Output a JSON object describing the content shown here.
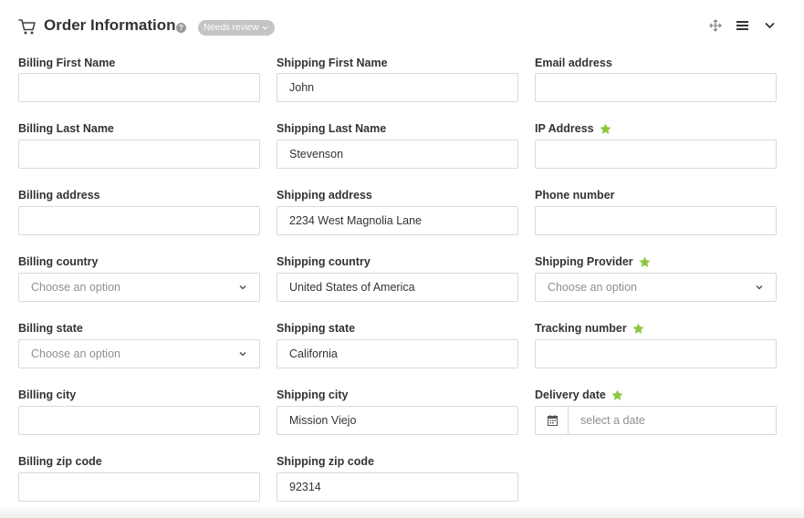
{
  "header": {
    "title": "Order Information",
    "help_icon": "question-circle-icon",
    "status_badge": "Needs review",
    "icons": [
      "cart-icon",
      "move-icon",
      "menu-icon",
      "chevron-down-icon"
    ]
  },
  "colors": {
    "star": "#8cc63f",
    "badge": "#c4c4c4",
    "border": "#d9d9d9",
    "label": "#333333",
    "placeholder": "#8f8f8f"
  },
  "billing": {
    "first_name": {
      "label": "Billing First Name",
      "value": ""
    },
    "last_name": {
      "label": "Billing Last Name",
      "value": ""
    },
    "address": {
      "label": "Billing address",
      "value": ""
    },
    "country": {
      "label": "Billing country",
      "placeholder": "Choose an option"
    },
    "state": {
      "label": "Billing state",
      "placeholder": "Choose an option"
    },
    "city": {
      "label": "Billing city",
      "value": ""
    },
    "zip": {
      "label": "Billing zip code",
      "value": ""
    }
  },
  "shipping": {
    "first_name": {
      "label": "Shipping First Name",
      "value": "John"
    },
    "last_name": {
      "label": "Shipping Last Name",
      "value": "Stevenson"
    },
    "address": {
      "label": "Shipping address",
      "value": "2234 West Magnolia Lane"
    },
    "country": {
      "label": "Shipping country",
      "value": "United States of America"
    },
    "state": {
      "label": "Shipping state",
      "value": "California"
    },
    "city": {
      "label": "Shipping city",
      "value": "Mission Viejo"
    },
    "zip": {
      "label": "Shipping zip code",
      "value": "92314"
    }
  },
  "other": {
    "email": {
      "label": "Email address",
      "value": ""
    },
    "ip": {
      "label": "IP Address",
      "value": "",
      "starred": true
    },
    "phone": {
      "label": "Phone number",
      "value": ""
    },
    "provider": {
      "label": "Shipping Provider",
      "placeholder": "Choose an option",
      "starred": true
    },
    "tracking": {
      "label": "Tracking number",
      "value": "",
      "starred": true
    },
    "delivery_date": {
      "label": "Delivery date",
      "placeholder": "select a date",
      "starred": true
    }
  }
}
